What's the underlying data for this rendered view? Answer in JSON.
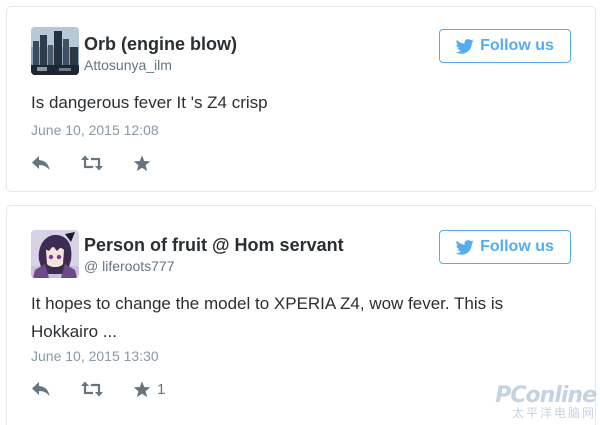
{
  "follow_label": "Follow us",
  "accent_color": "#55acee",
  "tweets": [
    {
      "display_name": "Orb (engine blow)",
      "screen_name": "Attosunya_ilm",
      "text": "Is dangerous fever It 's Z4 crisp",
      "timestamp": "June 10, 2015 12:08",
      "favorite_count": "",
      "avatar": "city-skyline-photo"
    },
    {
      "display_name": "Person of fruit @ Hom servant",
      "screen_name": "@ liferoots777",
      "text": "It hopes to change the model to XPERIA Z4, wow fever. This is Hokkairo ...",
      "timestamp": "June 10, 2015 13:30",
      "favorite_count": "1",
      "avatar": "anime-character-drawing"
    }
  ],
  "icons": {
    "reply": "reply-icon",
    "retweet": "retweet-icon",
    "favorite": "star-icon",
    "follow": "twitter-bird-icon"
  },
  "watermark": {
    "logo": "PConline",
    "sub": "太平洋电脑网"
  }
}
